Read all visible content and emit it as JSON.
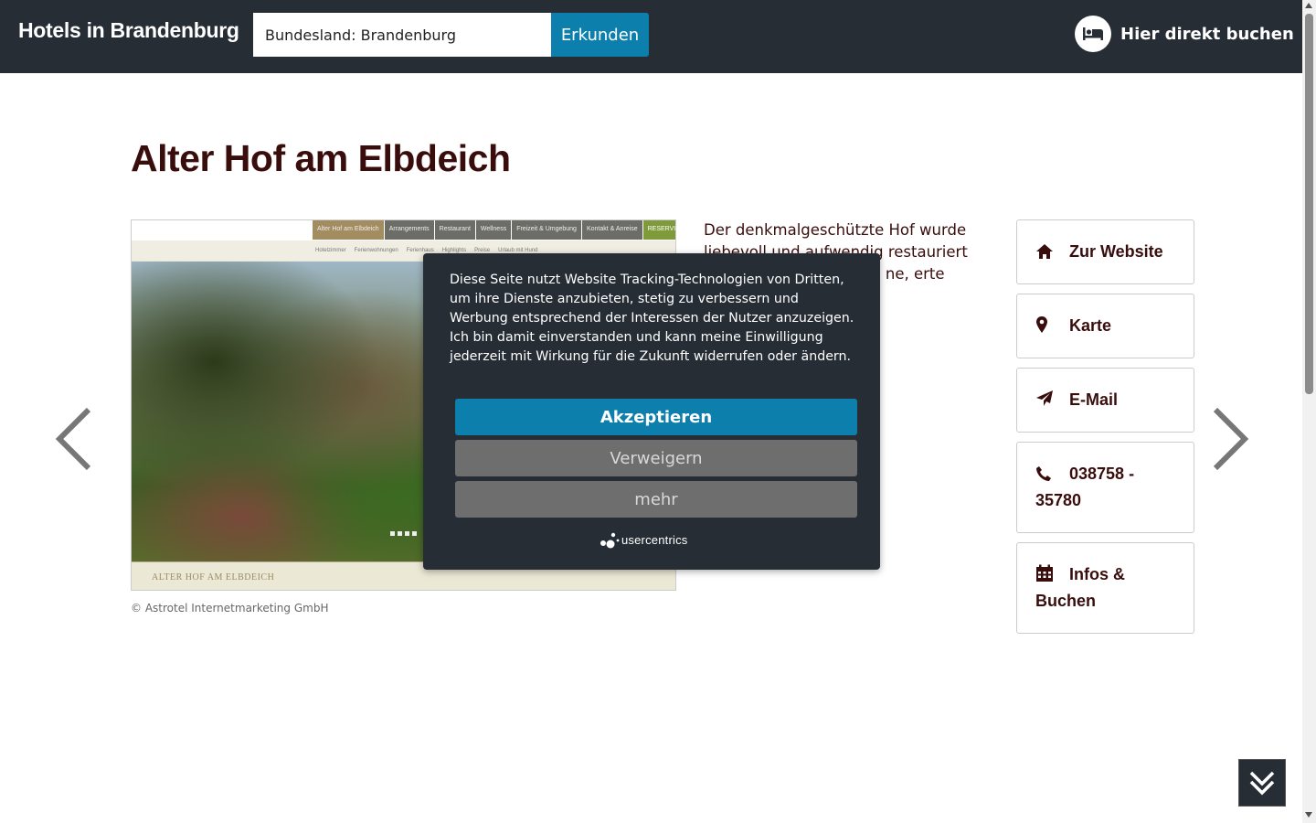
{
  "header": {
    "brand": "Hotels in Brandenburg",
    "search_value": "Bundesland: Brandenburg",
    "search_button": "Erkunden",
    "book_label": "Hier direkt buchen",
    "book_icon": "bed-icon"
  },
  "main": {
    "title": "Alter Hof am Elbdeich",
    "screenshot": {
      "nav_items": [
        "Alter Hof am Elbdeich",
        "Arrangements",
        "Restaurant",
        "Wellness",
        "Freizeit & Umgebung",
        "Kontakt & Anreise",
        "RESERVIERUNG"
      ],
      "sub_items": [
        "Hotelzimmer",
        "Ferienwohnungen",
        "Ferienhaus",
        "Highlights",
        "Preise",
        "Urlaub mit Hund"
      ],
      "footer": "ALTER HOF AM ELBDEICH"
    },
    "credit": "© Astrotel Internetmarketing GmbH",
    "description": "Der denkmalgeschützte Hof wurde liebevoll und aufwendig restauriert mit Ein ich und urant in ne, erte alten Besuch ein."
  },
  "side_buttons": [
    {
      "label": "Zur Website",
      "icon": "home-icon"
    },
    {
      "label": "Karte",
      "icon": "map-marker-icon"
    },
    {
      "label": "E-Mail",
      "icon": "paper-plane-icon"
    },
    {
      "label": "038758 - 35780",
      "icon": "phone-icon"
    },
    {
      "label": "Infos & Buchen",
      "icon": "calendar-icon"
    }
  ],
  "cookie": {
    "text": "Diese Seite nutzt Website Tracking-Technologien von Dritten, um ihre Dienste anzubieten, stetig zu verbessern und Werbung entsprechend der Interessen der Nutzer anzuzeigen. Ich bin damit einverstanden und kann meine Einwilligung jederzeit mit Wirkung für die Zukunft widerrufen oder ändern.",
    "accept": "Akzeptieren",
    "deny": "Verweigern",
    "more": "mehr",
    "logo": "usercentrics"
  },
  "colors": {
    "header_bg": "#262d35",
    "accent": "#0c7fad",
    "title": "#3a0d0d",
    "secondary_button": "#6e6e6e"
  }
}
